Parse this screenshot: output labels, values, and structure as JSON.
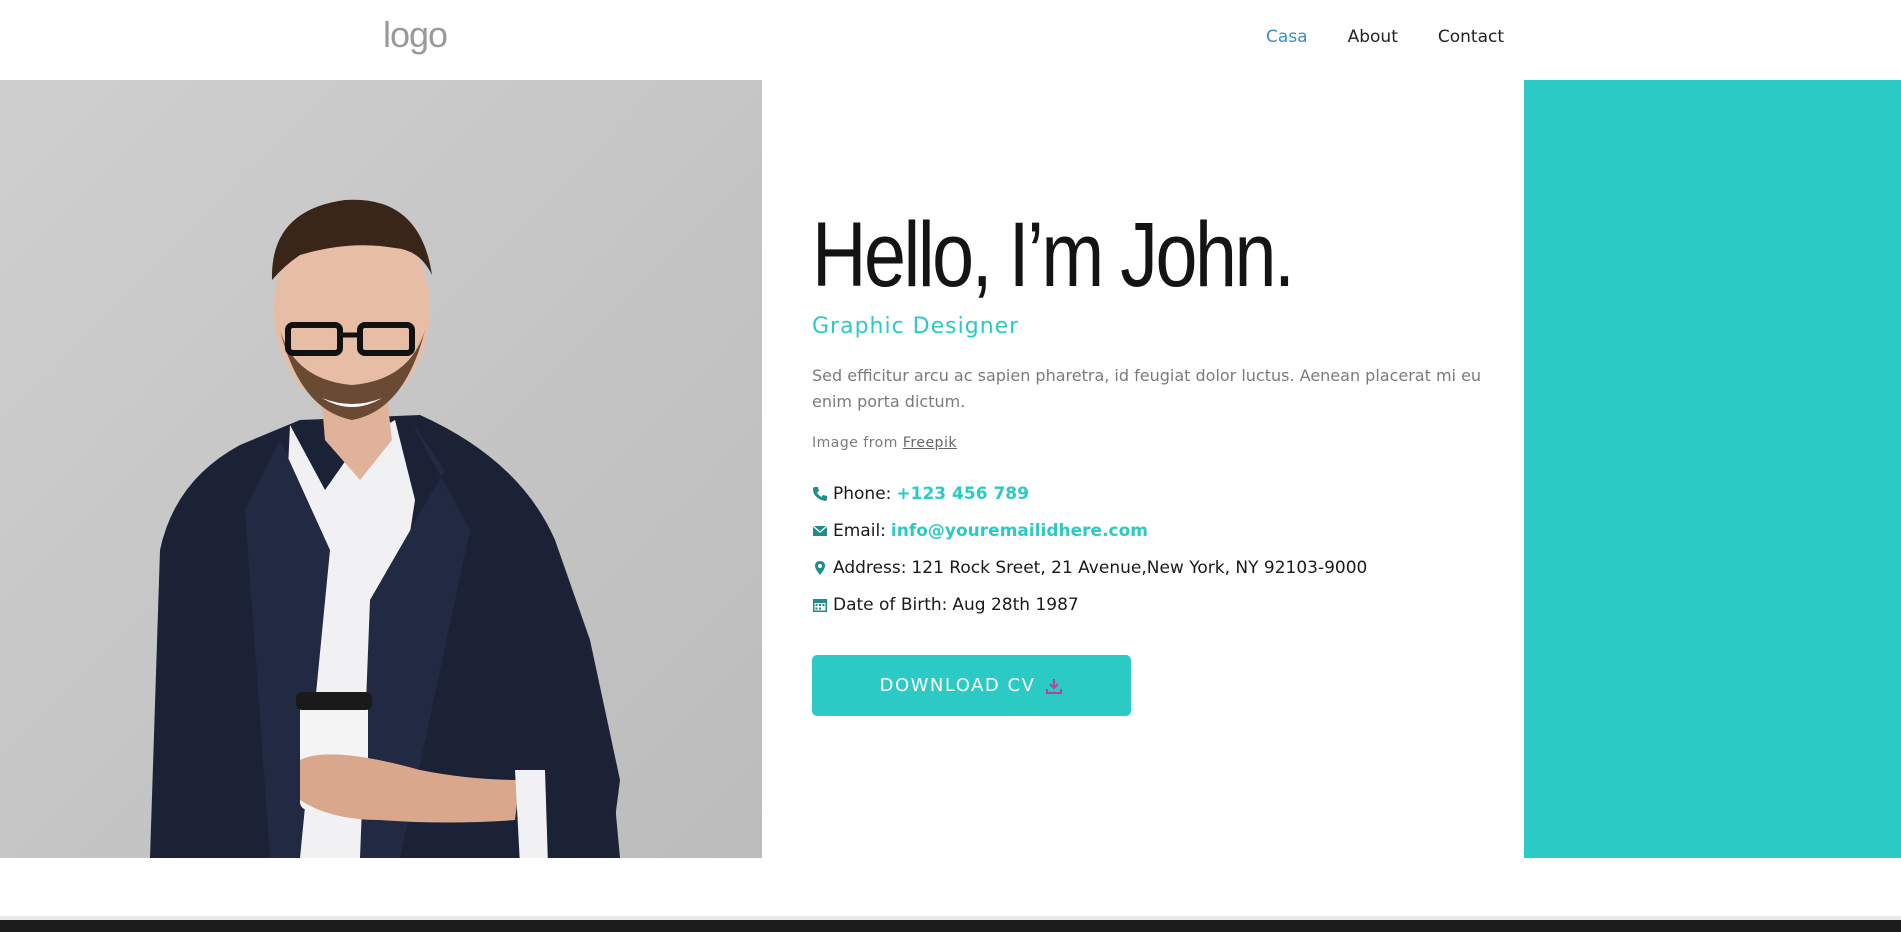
{
  "header": {
    "logo": "logo",
    "nav": [
      {
        "label": "Casa",
        "active": true
      },
      {
        "label": "About",
        "active": false
      },
      {
        "label": "Contact",
        "active": false
      }
    ]
  },
  "hero": {
    "heading": "Hello, I’m John.",
    "role": "Graphic Designer",
    "description": "Sed efficitur arcu ac sapien pharetra, id feugiat dolor luctus. Aenean placerat mi eu enim porta dictum.",
    "credit_prefix": "Image from",
    "credit_link": "Freepik",
    "info": {
      "phone_label": "Phone:",
      "phone_value": "+123 456 789",
      "email_label": "Email:",
      "email_value": "info@youremailidhere.com",
      "address_label": "Address:",
      "address_value": "121 Rock Sreet, 21 Avenue,New York, NY 92103-9000",
      "dob_label": "Date of Birth:",
      "dob_value": "Aug 28th 1987"
    },
    "download_label": "DOWNLOAD CV"
  },
  "colors": {
    "accent": "#2ccac4",
    "nav_active": "#3a8fc2",
    "download_icon": "#c2408f"
  },
  "icons": {
    "phone": "phone-icon",
    "email": "envelope-icon",
    "address": "map-pin-icon",
    "dob": "calendar-icon",
    "download": "download-icon"
  }
}
